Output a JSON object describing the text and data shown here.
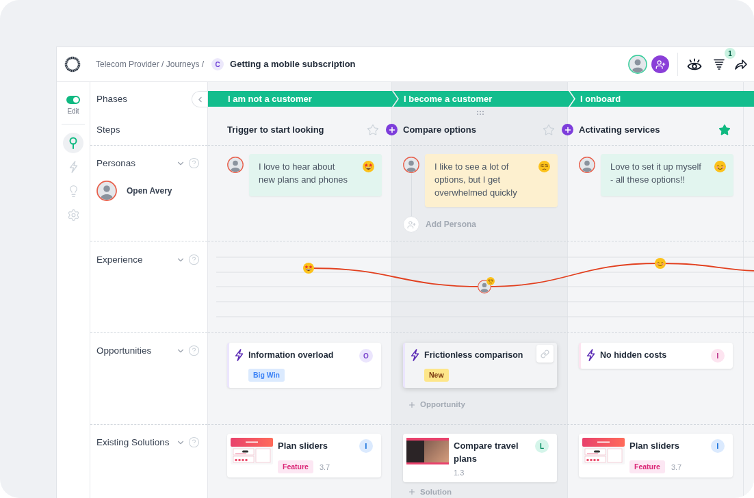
{
  "header": {
    "breadcrumb": "Telecom Provider / Journeys /",
    "journey_initial": "C",
    "title": "Getting a mobile subscription",
    "filter_count": "1"
  },
  "rail": {
    "edit": {
      "label": "Edit",
      "on": true
    },
    "items": [
      {
        "selected": true
      },
      {
        "selected": false
      },
      {
        "selected": false
      },
      {
        "selected": false
      }
    ]
  },
  "row_labels": {
    "phases": "Phases",
    "steps": "Steps",
    "personas": "Personas",
    "experience": "Experience",
    "opportunities": "Opportunities",
    "solutions": "Existing Solutions"
  },
  "persona": {
    "name": "Open Avery"
  },
  "phases": [
    {
      "label": "I am not a customer"
    },
    {
      "label": "I become a customer"
    },
    {
      "label": "I onboard"
    }
  ],
  "columns": [
    {
      "selected": false,
      "step": {
        "title": "Trigger to start looking",
        "starred": false
      },
      "note": {
        "text": "I love to hear about new plans and phones",
        "kind": "excited"
      },
      "opportunity": {
        "title": "Information overload",
        "initial": "O",
        "color": "#ebe5fd",
        "hovered": false,
        "tag": {
          "label": "Big Win",
          "kind": "impact"
        }
      },
      "solution": {
        "title": "Plan sliders",
        "initial": "I",
        "color": "#dbeafe",
        "kind": "app",
        "tag": {
          "label": "Feature",
          "kind": "type"
        },
        "score": "3.7"
      }
    },
    {
      "selected": true,
      "step": {
        "title": "Compare options",
        "starred": false
      },
      "note": {
        "text": "I like to see a lot of options, but I get overwhelmed quickly",
        "kind": "unamused"
      },
      "add_persona": "Add Persona",
      "opportunity": {
        "title": "Frictionless comparison",
        "color": "#ebe5fd",
        "hovered": true,
        "tag": {
          "label": "New",
          "kind": "status"
        }
      },
      "add_opportunity": "Opportunity",
      "solution": {
        "title": "Compare travel plans",
        "initial": "L",
        "color": "#d5f5ea",
        "kind": "photo",
        "score": "1.3"
      },
      "add_solution": "Solution"
    },
    {
      "selected": false,
      "step": {
        "title": "Activating services",
        "starred": true
      },
      "note": {
        "text": "Love to set it up myself - all these options!!",
        "kind": "happy"
      },
      "opportunity": {
        "title": "No hidden costs",
        "initial": "I",
        "color": "#fde4f0",
        "hovered": false
      },
      "solution": {
        "title": "Plan sliders",
        "initial": "I",
        "color": "#dbeafe",
        "kind": "app",
        "tag": {
          "label": "Feature",
          "kind": "type"
        },
        "score": "3.7"
      }
    }
  ]
}
